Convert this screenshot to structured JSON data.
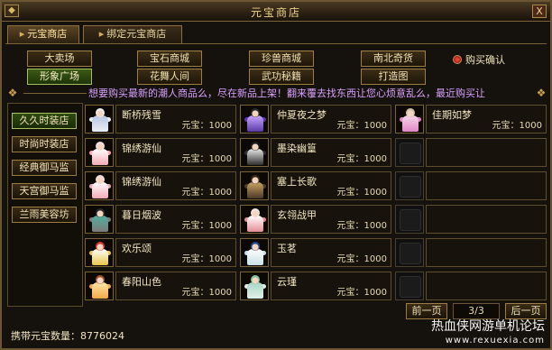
{
  "window": {
    "title": "元宝商店",
    "close_label": "X"
  },
  "tabs": [
    {
      "label": "元宝商店",
      "active": true
    },
    {
      "label": "绑定元宝商店",
      "active": false
    }
  ],
  "categories": [
    {
      "label": "大卖场",
      "active": false
    },
    {
      "label": "宝石商城",
      "active": false
    },
    {
      "label": "珍兽商城",
      "active": false
    },
    {
      "label": "南北奇货",
      "active": false
    },
    {
      "label": "形象广场",
      "active": true
    },
    {
      "label": "花舞人间",
      "active": false
    },
    {
      "label": "武功秘籍",
      "active": false
    },
    {
      "label": "打造图",
      "active": false
    }
  ],
  "confirm_label": "购买确认",
  "marquee": "想要购买最新的潮人商品么，尽在新品上架！翻来覆去找东西让您心烦意乱么，最近购买让",
  "sidebar": [
    {
      "label": "久久时装店",
      "active": true
    },
    {
      "label": "时尚时装店",
      "active": false
    },
    {
      "label": "经典御马监",
      "active": false
    },
    {
      "label": "天宫御马监",
      "active": false
    },
    {
      "label": "兰雨美容坊",
      "active": false
    }
  ],
  "price_label": "元宝：",
  "items": [
    [
      {
        "name": "断桥残雪",
        "price": "1000",
        "colors": {
          "hair": "#f1f1f1",
          "robe": "#eaeef6",
          "accent": "#b7c6e2"
        }
      },
      {
        "name": "仲夏夜之梦",
        "price": "1000",
        "colors": {
          "hair": "#2a2a2a",
          "robe": "#5b3aa8",
          "accent": "#c8a8ff"
        }
      },
      {
        "name": "佳期如梦",
        "price": "1000",
        "colors": {
          "hair": "#d9c1a8",
          "robe": "#e486c6",
          "accent": "#f5d6ea"
        }
      }
    ],
    [
      {
        "name": "锦绣游仙",
        "price": "1000",
        "colors": {
          "hair": "#f4dede",
          "robe": "#f3aab6",
          "accent": "#ffffff"
        }
      },
      {
        "name": "墨染幽篁",
        "price": "1000",
        "colors": {
          "hair": "#1c1c1c",
          "robe": "#2f2f2f",
          "accent": "#e8e8e8"
        }
      },
      null
    ],
    [
      {
        "name": "锦绣游仙",
        "price": "1000",
        "colors": {
          "hair": "#f4dede",
          "robe": "#f3aab6",
          "accent": "#ffffff"
        }
      },
      {
        "name": "塞上长歌",
        "price": "1000",
        "colors": {
          "hair": "#3b2a1c",
          "robe": "#4a3a2a",
          "accent": "#c8a460"
        }
      },
      null
    ],
    [
      {
        "name": "暮日烟波",
        "price": "1000",
        "colors": {
          "hair": "#2a2a2a",
          "robe": "#7c7c78",
          "accent": "#4fb0a0"
        }
      },
      {
        "name": "玄翎战甲",
        "price": "1000",
        "colors": {
          "hair": "#f2e6e6",
          "robe": "#e48e98",
          "accent": "#ffffff"
        }
      },
      null
    ],
    [
      {
        "name": "欢乐颂",
        "price": "1000",
        "colors": {
          "hair": "#d23a2a",
          "robe": "#e8c648",
          "accent": "#ffffff"
        }
      },
      {
        "name": "玉茗",
        "price": "1000",
        "colors": {
          "hair": "#2a4a8a",
          "robe": "#c8e0e8",
          "accent": "#ffffff"
        }
      },
      null
    ],
    [
      {
        "name": "春阳山色",
        "price": "1000",
        "colors": {
          "hair": "#a0542a",
          "robe": "#f0a848",
          "accent": "#ffe6a8"
        }
      },
      {
        "name": "云瑾",
        "price": "1000",
        "colors": {
          "hair": "#80c0a0",
          "robe": "#e0f0e8",
          "accent": "#a8d8c8"
        }
      },
      null
    ]
  ],
  "pager": {
    "prev_label": "前一页",
    "page": "3/3",
    "next_label": "后一页"
  },
  "footer": {
    "label": "携带元宝数量：",
    "value": "8776024"
  },
  "watermark": {
    "line1": "热血侠网游单机论坛",
    "line2": "www.rexuexia.com"
  }
}
